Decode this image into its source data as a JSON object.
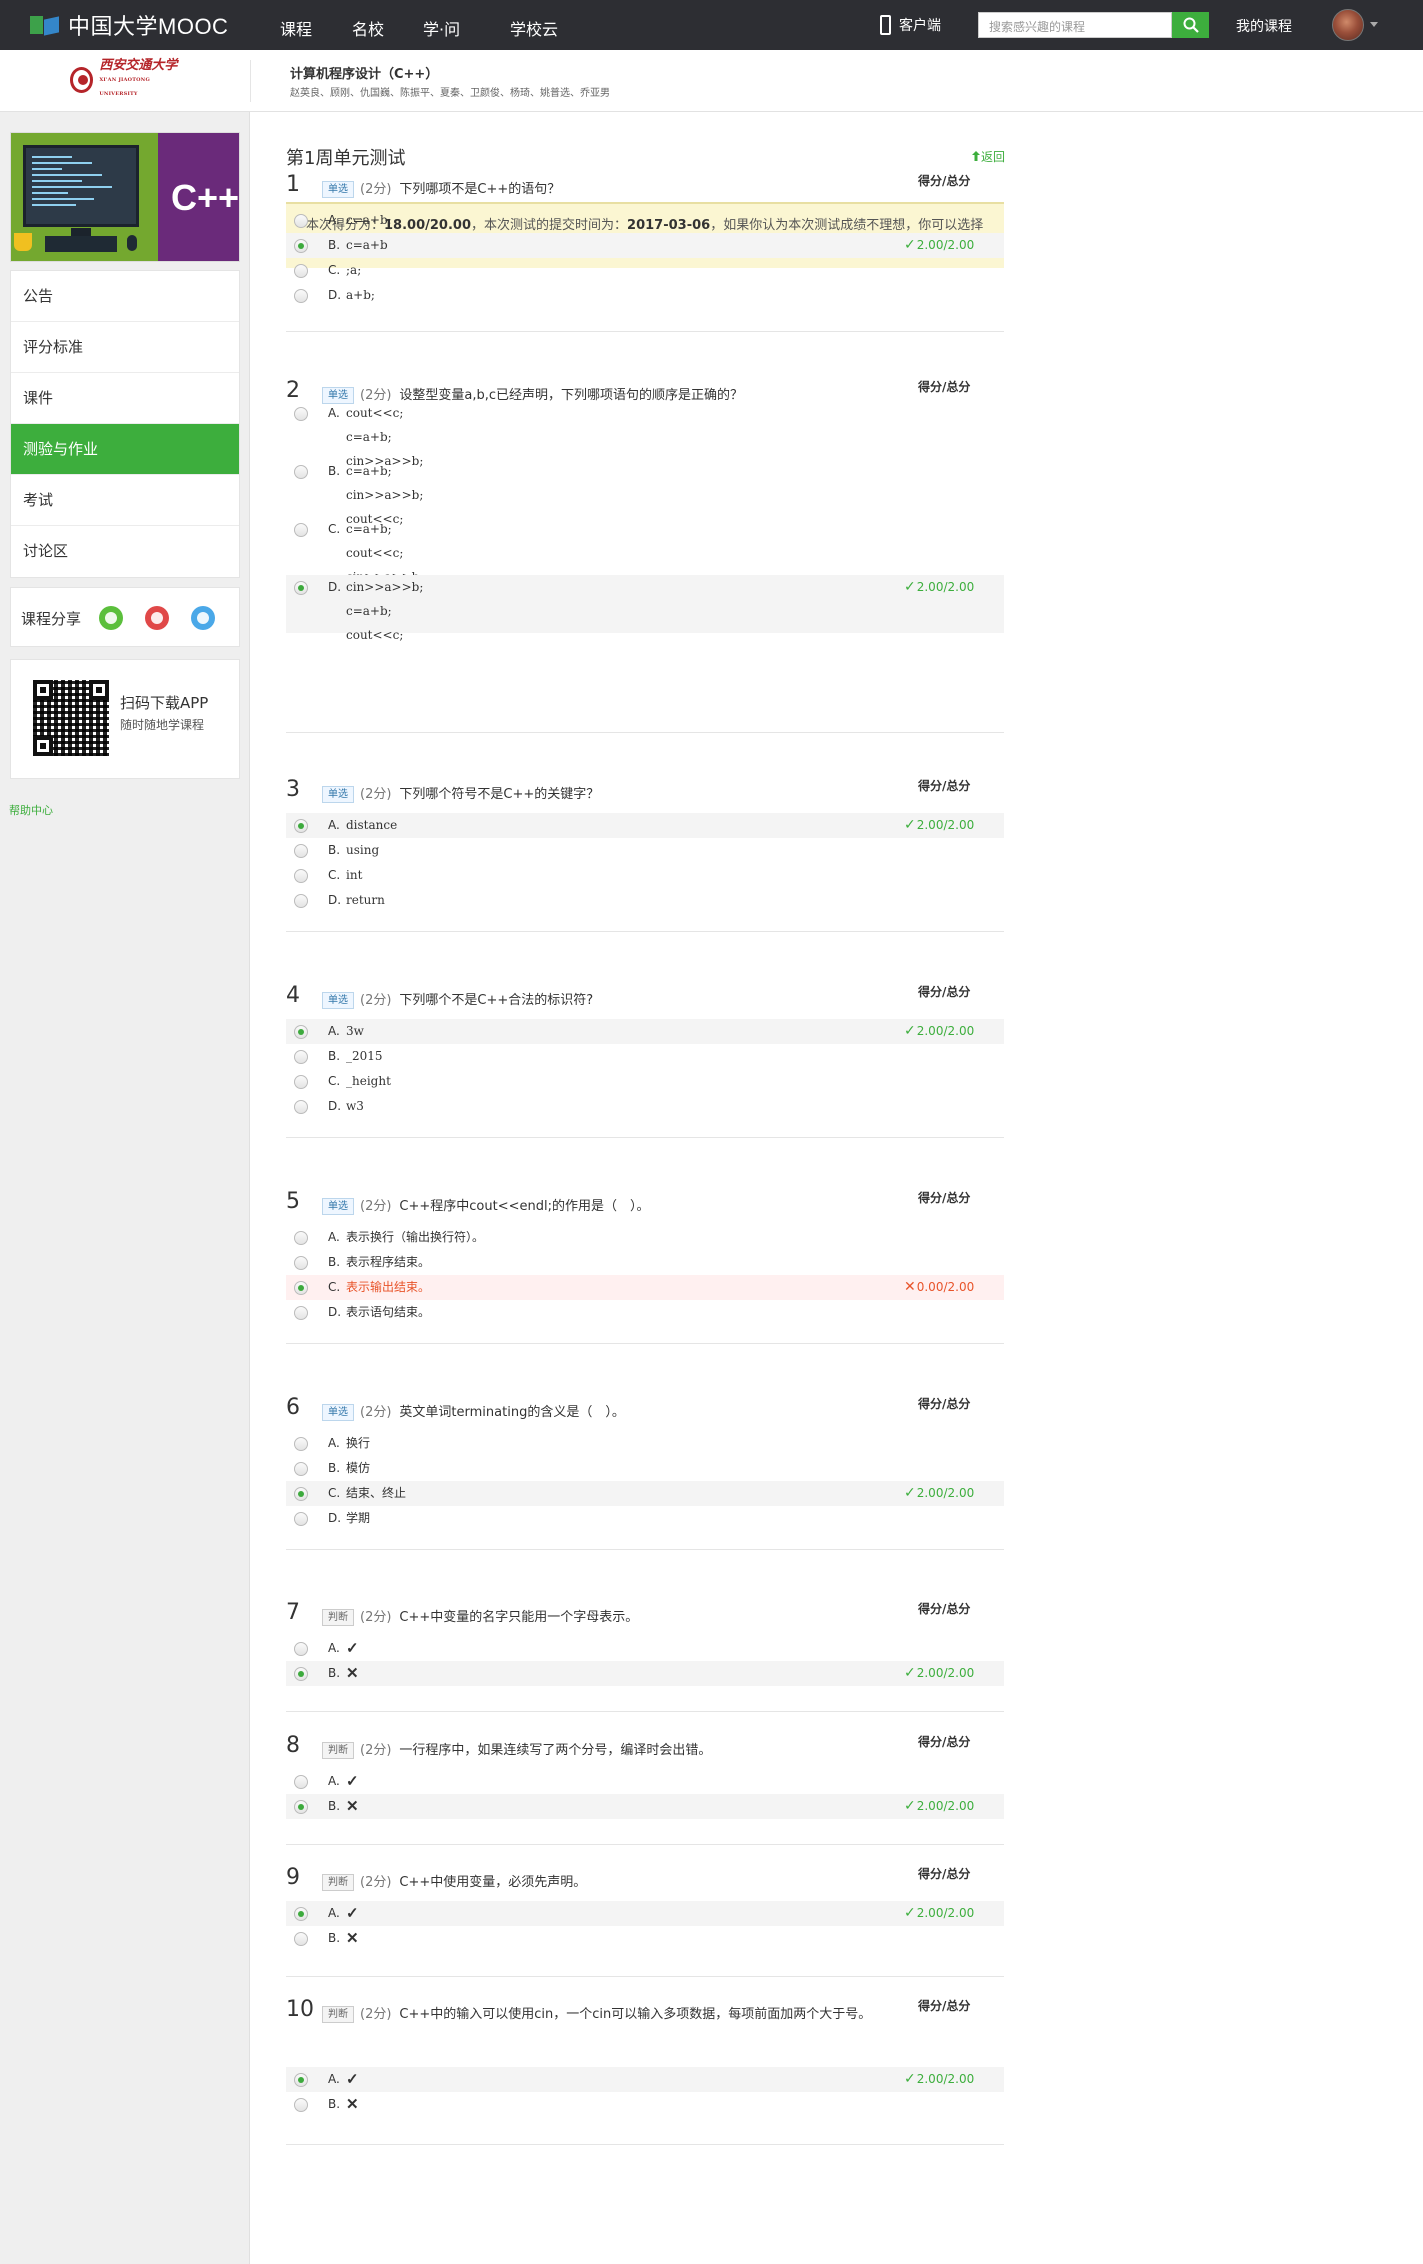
{
  "nav": {
    "logo_text": "中国大学MOOC",
    "links": [
      "课程",
      "名校",
      "学·问",
      "学校云"
    ],
    "client_label": "客户端",
    "search_placeholder": "搜索感兴趣的课程",
    "my_courses": "我的课程"
  },
  "course": {
    "university_name": "西安交通大学",
    "university_en": "XI'AN JIAOTONG UNIVERSITY",
    "title": "计算机程序设计（C++）",
    "teachers": "赵英良、顾刚、仇国巍、陈振平、夏秦、卫颜俊、杨琦、姚普选、乔亚男"
  },
  "sidebar": {
    "cover_label": "C++",
    "menu": [
      "公告",
      "评分标准",
      "课件",
      "测验与作业",
      "考试",
      "讨论区"
    ],
    "active_index": 3,
    "share_label": "课程分享",
    "share_icons": [
      "wechat-icon",
      "weibo-icon",
      "qq-icon"
    ],
    "app_title": "扫码下载APP",
    "app_sub": "随时随地学课程",
    "help": "帮助中心"
  },
  "quiz": {
    "title": "第1周单元测试",
    "back": "返回",
    "notice_prefix": "本次得分为：",
    "score": "18.00/20.00",
    "notice_mid": "，本次测试的提交时间为：",
    "submit_date": "2017-03-06",
    "notice_suffix": "，如果你认为本次测试成绩不理想，你可以选择再做一次。",
    "score_label": "得分/总分",
    "questions": [
      {
        "num": "1",
        "type": "单选",
        "points": "(2分)",
        "text": "下列哪项不是C++的语句？",
        "options": [
          {
            "letter": "A.",
            "text": "c=a+b;"
          },
          {
            "letter": "B.",
            "text": "c=a+b",
            "result": "2.00/2.00"
          },
          {
            "letter": "C.",
            "text": ";a;"
          },
          {
            "letter": "D.",
            "text": "a+b;"
          }
        ]
      },
      {
        "num": "2",
        "type": "单选",
        "points": "(2分)",
        "text": "设整型变量a,b,c已经声明，下列哪项语句的顺序是正确的？",
        "options": [
          {
            "letter": "A.",
            "text": "cout<<c;\nc=a+b;\ncin>>a>>b;"
          },
          {
            "letter": "B.",
            "text": "c=a+b;\ncin>>a>>b;\ncout<<c;"
          },
          {
            "letter": "C.",
            "text": "c=a+b;\ncout<<c;\ncin>>a>>b;"
          },
          {
            "letter": "D.",
            "text": "cin>>a>>b;\nc=a+b;\ncout<<c;",
            "result": "2.00/2.00"
          }
        ]
      },
      {
        "num": "3",
        "type": "单选",
        "points": "(2分)",
        "text": "下列哪个符号不是C++的关键字？",
        "options": [
          {
            "letter": "A.",
            "text": "distance",
            "result": "2.00/2.00"
          },
          {
            "letter": "B.",
            "text": "using"
          },
          {
            "letter": "C.",
            "text": "int"
          },
          {
            "letter": "D.",
            "text": "return"
          }
        ]
      },
      {
        "num": "4",
        "type": "单选",
        "points": "(2分)",
        "text": "下列哪个不是C++合法的标识符?",
        "options": [
          {
            "letter": "A.",
            "text": "3w",
            "result": "2.00/2.00"
          },
          {
            "letter": "B.",
            "text": "_2015"
          },
          {
            "letter": "C.",
            "text": "_height"
          },
          {
            "letter": "D.",
            "text": "w3"
          }
        ]
      },
      {
        "num": "5",
        "type": "单选",
        "points": "(2分)",
        "text": "C++程序中cout<<endl;的作用是（　）。",
        "options": [
          {
            "letter": "A.",
            "text": "表示换行（输出换行符）。"
          },
          {
            "letter": "B.",
            "text": "表示程序结束。"
          },
          {
            "letter": "C.",
            "text": "表示输出结束。",
            "result": "0.00/2.00",
            "wrong": true
          },
          {
            "letter": "D.",
            "text": "表示语句结束。"
          }
        ]
      },
      {
        "num": "6",
        "type": "单选",
        "points": "(2分)",
        "text": "英文单词terminating的含义是（　）。",
        "options": [
          {
            "letter": "A.",
            "text": "换行"
          },
          {
            "letter": "B.",
            "text": "模仿"
          },
          {
            "letter": "C.",
            "text": "结束、终止",
            "result": "2.00/2.00"
          },
          {
            "letter": "D.",
            "text": "学期"
          }
        ]
      },
      {
        "num": "7",
        "type": "判断",
        "points": "(2分)",
        "text": "C++中变量的名字只能用一个字母表示。",
        "options": [
          {
            "letter": "A.",
            "text": "✓"
          },
          {
            "letter": "B.",
            "text": "✕",
            "result": "2.00/2.00"
          }
        ]
      },
      {
        "num": "8",
        "type": "判断",
        "points": "(2分)",
        "text": "一行程序中，如果连续写了两个分号，编译时会出错。",
        "options": [
          {
            "letter": "A.",
            "text": "✓"
          },
          {
            "letter": "B.",
            "text": "✕",
            "result": "2.00/2.00"
          }
        ]
      },
      {
        "num": "9",
        "type": "判断",
        "points": "(2分)",
        "text": "C++中使用变量，必须先声明。",
        "options": [
          {
            "letter": "A.",
            "text": "✓",
            "result": "2.00/2.00"
          },
          {
            "letter": "B.",
            "text": "✕"
          }
        ]
      },
      {
        "num": "10",
        "type": "判断",
        "points": "(2分)",
        "text": "C++中的输入可以使用cin，一个cin可以输入多项数据，每项前面加两个大于号。",
        "options": [
          {
            "letter": "A.",
            "text": "✓",
            "result": "2.00/2.00"
          },
          {
            "letter": "B.",
            "text": "✕"
          }
        ]
      }
    ]
  },
  "colors": {
    "accent": "#3dae3d",
    "nav_bg": "#2d2e33",
    "wrong": "#e8542a"
  }
}
